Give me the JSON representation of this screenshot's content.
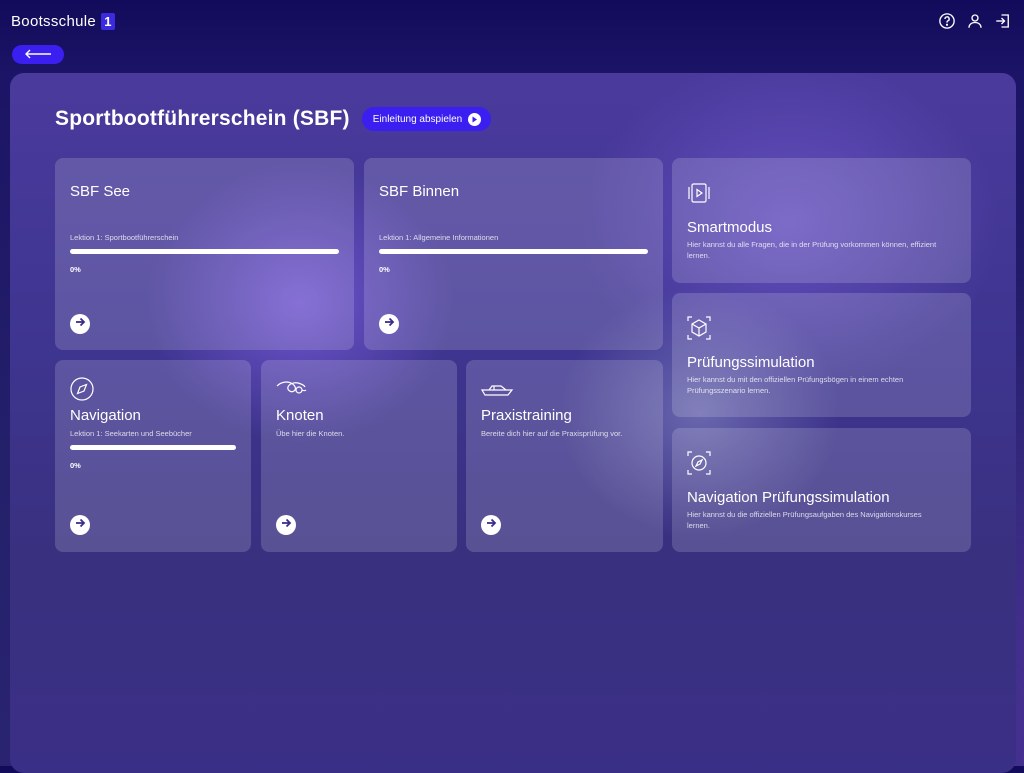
{
  "brand": {
    "name": "Bootsschule",
    "badge": "1"
  },
  "header_icons": [
    "help-icon",
    "user-icon",
    "logout-icon"
  ],
  "page": {
    "title": "Sportbootführerschein (SBF)",
    "intro_button": "Einleitung abspielen"
  },
  "cards": {
    "sbf_see": {
      "title": "SBF See",
      "lesson": "Lektion 1: Sportbootführerschein",
      "progress": "0%"
    },
    "sbf_binnen": {
      "title": "SBF Binnen",
      "lesson": "Lektion 1: Allgemeine Informationen",
      "progress": "0%"
    },
    "navigation": {
      "title": "Navigation",
      "lesson": "Lektion 1: Seekarten und Seebücher",
      "progress": "0%"
    },
    "knoten": {
      "title": "Knoten",
      "desc": "Übe hier die Knoten."
    },
    "praxis": {
      "title": "Praxistraining",
      "desc": "Bereite dich hier auf die Praxisprüfung vor."
    },
    "smart": {
      "title": "Smartmodus",
      "desc": "Hier kannst du alle Fragen, die in der Prüfung vorkommen können, effizient lernen."
    },
    "pruefung": {
      "title": "Prüfungssimulation",
      "desc": "Hier kannst du mit den offiziellen Prüfungsbögen in einem echten Prüfungsszenario lernen."
    },
    "navpruef": {
      "title": "Navigation Prüfungssimulation",
      "desc": "Hier kannst du die offiziellen Prüfungsaufgaben des Navigationskurses lernen."
    }
  },
  "colors": {
    "accent": "#3b1ef0",
    "card": "rgba(255,255,255,0.16)"
  }
}
